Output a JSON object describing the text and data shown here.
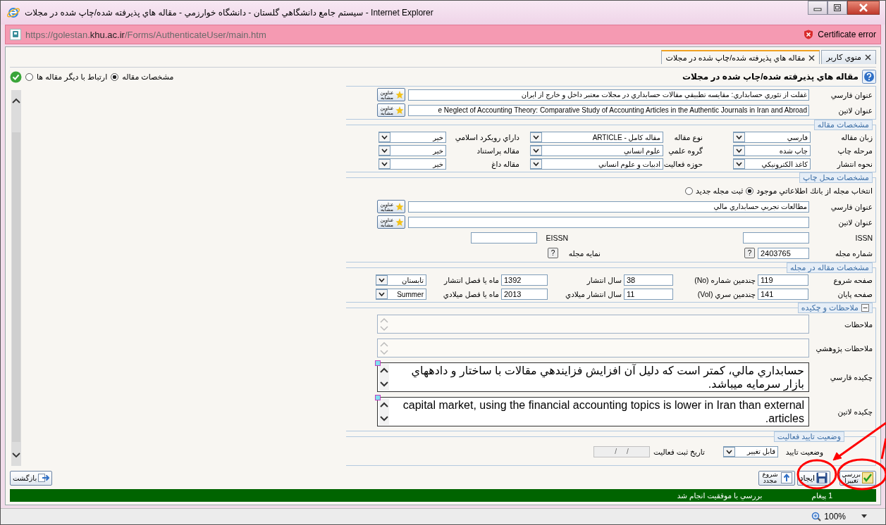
{
  "window": {
    "title": "سيستم جامع دانشگاهي گلستان - دانشگاه خوارزمي - مقاله هاي پذيرفته شده/چاپ شده در مجلات - Internet Explorer"
  },
  "address_bar": {
    "url": "https://golestan.**khu.ac.ir**/Forms/AuthenticateUser/main.htm",
    "security": "Certificate error"
  },
  "tabs": [
    {
      "label": "منوي كاربر",
      "selected": false
    },
    {
      "label": "مقاله هاي پذيرفته شده/چاپ شده در مجلات",
      "selected": true
    }
  ],
  "page_title": "مقاله هاي پذيرفته شده/چاپ شده در مجلات",
  "view_options": [
    {
      "label": "مشخصات مقاله",
      "selected": true
    },
    {
      "label": "ارتباط با ديگر مقاله ها",
      "selected": false
    }
  ],
  "titles": [
    {
      "label": "عنوان فارسي",
      "value": "غفلت از تئوري حسابداري: مقايسه تطبيقي مقالات حسابداري در مجلات معتبر داخل و خارج از ايران",
      "similar_button": "عناوين مشابه"
    },
    {
      "label": "عنوان لاتين",
      "value": "e Neglect of Accounting Theory: Comparative Study of Accounting Articles in the Authentic Journals in Iran and Abroad",
      "similar_button": "عناوين مشابه"
    }
  ],
  "article_specs": {
    "legend": "مشخصات مقاله",
    "fields": [
      {
        "label": "زبان مقاله",
        "value": "فارسي"
      },
      {
        "label": "نوع مقاله",
        "value": "مقاله كامل - ARTICLE"
      },
      {
        "label": "داراي رويكرد اسلامي",
        "value": "خير"
      },
      {
        "label": "مرحله چاپ",
        "value": "چاپ شده"
      },
      {
        "label": "گروه علمي",
        "value": "علوم انساني"
      },
      {
        "label": "مقاله پراستناد",
        "value": "خير"
      },
      {
        "label": "نحوه انتشار",
        "value": "كاغذ الكترونيكي"
      },
      {
        "label": "حوزه فعاليت",
        "value": "ادبيات و علوم انساني"
      },
      {
        "label": "مقاله داغ",
        "value": "خير"
      }
    ]
  },
  "publication_place": {
    "legend": "مشخصات محل چاپ",
    "source_options": [
      {
        "label": "انتخاب مجله از بانك اطلاعاتي موجود",
        "selected": true
      },
      {
        "label": "ثبت مجله جديد",
        "selected": false
      }
    ],
    "journal_titles": [
      {
        "label": "عنوان فارسي",
        "value": "مطالعات تجربي حسابداري مالي",
        "similar_button": "عناوين مشابه"
      },
      {
        "label": "عنوان لاتين",
        "similar_button": "عناوين مشابه"
      }
    ],
    "issn_label": "ISSN",
    "eissn_label": "EISSN",
    "journal_number": {
      "label": "شماره مجله",
      "value": "2403765",
      "help_button": "?"
    },
    "journal_index": {
      "label": "نمايه مجله",
      "help_button": "?"
    }
  },
  "issue_specs": {
    "legend": "مشخصات مقاله در مجله",
    "fields": [
      {
        "label": "صفحه شروع",
        "value": "119",
        "kind": "text"
      },
      {
        "label": "چندمين شماره (No)",
        "value": "38",
        "kind": "text"
      },
      {
        "label": "سال انتشار",
        "value": "1392",
        "kind": "text"
      },
      {
        "label": "ماه يا فصل انتشار",
        "value": "تابستان",
        "kind": "select"
      },
      {
        "label": "صفحه پايان",
        "value": "141",
        "kind": "text"
      },
      {
        "label": "چندمين سري (Vol)",
        "value": "11",
        "kind": "text"
      },
      {
        "label": "سال انتشار ميلادي",
        "value": "2013",
        "kind": "text"
      },
      {
        "label": "ماه يا فصل ميلادي",
        "value": "Summer",
        "kind": "select"
      }
    ]
  },
  "notes": {
    "legend": "ملاحظات و چكيده",
    "expanded": true,
    "fields": [
      {
        "label": "ملاحظات",
        "kind": "small"
      },
      {
        "label": "ملاحظات پژوهشي",
        "kind": "small"
      },
      {
        "label": "چكيده فارسي",
        "value": "حسابداري مالي، كمتر است كه دليل آن افزايش فزايندهي مقالات با ساختار و دادههاي بازار سرمايه ميباشد.",
        "kind": "large"
      },
      {
        "label": "چكيده لاتين",
        "value": "capital market, using the financial accounting topics is lower in Iran than external articles.",
        "kind": "large"
      }
    ]
  },
  "approval": {
    "legend": "وضعيت تاييد فعاليت",
    "status_label": "وضعيت تاييد",
    "status_value": "قابل تغيير",
    "date_label": "تاريخ ثبت فعاليت",
    "date_value": "/     /",
    "date_disabled": true
  },
  "actions": [
    {
      "label": "بررسي تغييرا",
      "kind": "check"
    },
    {
      "label": "ايجاد",
      "kind": "save"
    },
    {
      "label": "شروع مجدد",
      "kind": "reset"
    }
  ],
  "back_button": "بازگشت",
  "messages": {
    "count": "1 پيغام",
    "text": "بررسي با موفقيت انجام شد"
  },
  "status_bar": {
    "zoom": "100%"
  }
}
